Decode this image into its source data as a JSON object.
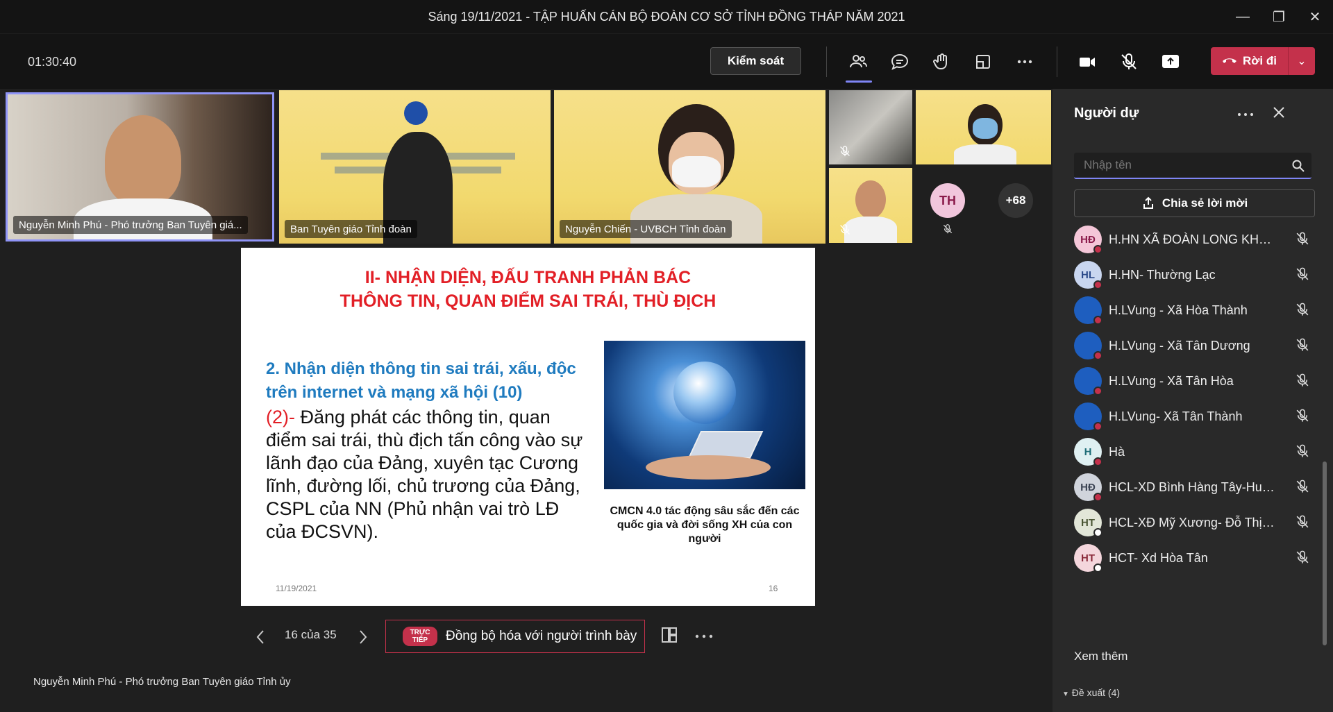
{
  "window": {
    "title": "Sáng 19/11/2021 - TẬP HUẤN CÁN BỘ ĐOÀN CƠ SỞ TỈNH ĐỒNG THÁP NĂM 2021",
    "minimize": "—",
    "restore": "❐",
    "close": "✕"
  },
  "toolbar": {
    "timer": "01:30:40",
    "control_label": "Kiểm soát",
    "leave_label": "Rời đi",
    "leave_drop": "⌄"
  },
  "tiles": [
    {
      "name": "Nguyễn Minh Phú - Phó trưởng Ban Tuyên giá...",
      "bg": "#bdb6ae"
    },
    {
      "name": "Ban Tuyên giáo Tỉnh đoàn",
      "bg": "#f2d96e"
    },
    {
      "name": "Nguyễn Chiến - UVBCH Tỉnh đoàn",
      "bg": "#f2d96e"
    }
  ],
  "small_tiles": {
    "th_initials": "TH",
    "overflow": "+68"
  },
  "slide": {
    "heading_line1": "II- NHẬN DIỆN, ĐẤU TRANH PHẢN BÁC",
    "heading_line2": "THÔNG TIN, QUAN ĐIỂM SAI TRÁI, THÙ ĐỊCH",
    "subheading": "2. Nhận diện thông tin sai trái, xấu, độc trên internet và mạng xã hội (10)",
    "body_marker": "(2)-",
    "body_text": " Đăng phát các thông tin, quan điểm sai trái, thù địch tấn công vào sự lãnh đạo của Đảng, xuyên tạc Cương lĩnh, đường lối, chủ trương của Đảng, CSPL của NN (Phủ nhận vai trò LĐ của ĐCSVN).",
    "caption": "CMCN 4.0 tác động sâu sắc đến các quốc gia và đời sống XH của con người",
    "date": "11/19/2021",
    "number": "16"
  },
  "share": {
    "page_indicator": "16 của 35",
    "live_badge": "TRỰC TIẾP",
    "sync_label": "Đồng bộ hóa với người trình bày"
  },
  "presenter_name": "Nguyễn Minh Phú - Phó trưởng Ban Tuyên giáo Tỉnh ủy",
  "panel": {
    "title": "Người dự",
    "search_placeholder": "Nhập tên",
    "invite_label": "Chia sẻ lời mời",
    "participants": [
      {
        "initials": "HĐ",
        "name": "H.HN XÃ ĐOÀN LONG KHÁN...",
        "bg": "#f4c6d8",
        "fg": "#8a1a4a",
        "status": "#c4314b"
      },
      {
        "initials": "HL",
        "name": "H.HN- Thường Lạc",
        "bg": "#c9d6f0",
        "fg": "#2c4a8a",
        "status": "#c4314b"
      },
      {
        "initials": "",
        "name": "H.LVung - Xã Hòa Thành",
        "bg": "#1e5ebf",
        "fg": "#fff",
        "status": "#c4314b"
      },
      {
        "initials": "",
        "name": "H.LVung - Xã Tân Dương",
        "bg": "#1e5ebf",
        "fg": "#fff",
        "status": "#c4314b"
      },
      {
        "initials": "",
        "name": "H.LVung - Xã Tân Hòa",
        "bg": "#1e5ebf",
        "fg": "#fff",
        "status": "#c4314b"
      },
      {
        "initials": "",
        "name": "H.LVung- Xã Tân Thành",
        "bg": "#1e5ebf",
        "fg": "#fff",
        "status": "#c4314b"
      },
      {
        "initials": "H",
        "name": "Hà",
        "bg": "#dff0f2",
        "fg": "#1f6e78",
        "status": "#c4314b"
      },
      {
        "initials": "HĐ",
        "name": "HCL-XD Bình Hàng Tây-Huỳn...",
        "bg": "#d0d4dc",
        "fg": "#3c4454",
        "status": "#c4314b"
      },
      {
        "initials": "HT",
        "name": "HCL-XĐ Mỹ Xương- Đỗ Thị T...",
        "bg": "#e2e6d8",
        "fg": "#4a5634",
        "status": "#fff"
      },
      {
        "initials": "HT",
        "name": "HCT- Xd Hòa Tân",
        "bg": "#f4d6dc",
        "fg": "#8a2a3a",
        "status": "#fff"
      }
    ],
    "see_more": "Xem thêm",
    "suggested": "Đề xuất (4)"
  }
}
